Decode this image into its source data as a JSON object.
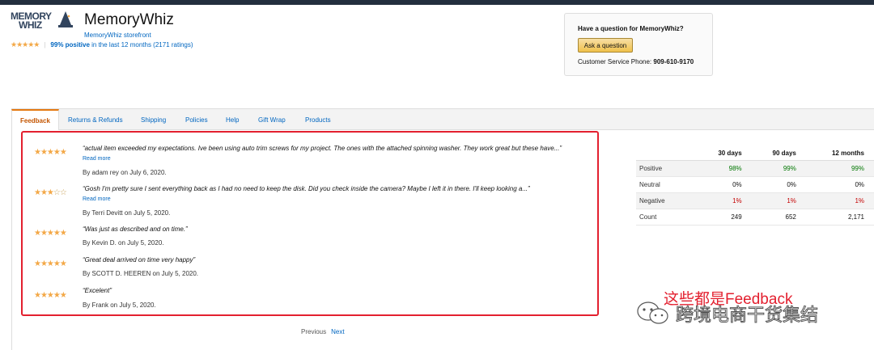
{
  "store": {
    "logo_line1": "MEMORY",
    "logo_line2": "WHIZ",
    "name": "MemoryWhiz",
    "storefront_link": "MemoryWhiz storefront",
    "rating_stars": "★★★★★",
    "positive": "99% positive",
    "rating_tail": "in the last 12 months (2171 ratings)"
  },
  "question_box": {
    "title": "Have a question for MemoryWhiz?",
    "ask_button": "Ask a question",
    "phone_label": "Customer Service Phone:",
    "phone": "909-610-9170"
  },
  "tabs": [
    "Feedback",
    "Returns & Refunds",
    "Shipping",
    "Policies",
    "Help",
    "Gift Wrap",
    "Products"
  ],
  "feedback": [
    {
      "stars": "★★★★★",
      "quote": "“actual item exceeded my expectations. Ive been using auto trim screws for my project. The ones with the attached spinning washer. They work great but these have...”",
      "read_more": "Read more",
      "by": "By adam rey on July 6, 2020.",
      "rating": 5
    },
    {
      "stars": "★★★",
      "empty_stars": "☆☆",
      "quote": "“Gosh I'm pretty sure I sent everything back as I had no need to keep the disk. Did you check inside the camera? Maybe I left it in there. I'll keep looking a...”",
      "read_more": "Read more",
      "by": "By Terri Devitt on July 5, 2020.",
      "rating": 3
    },
    {
      "stars": "★★★★★",
      "quote": "“Was just as described and on time.”",
      "by": "By Kevin D. on July 5, 2020.",
      "rating": 5
    },
    {
      "stars": "★★★★★",
      "quote": "“Great deal arrived on time very happy”",
      "by": "By SCOTT D. HEEREN on July 5, 2020.",
      "rating": 5
    },
    {
      "stars": "★★★★★",
      "quote": "“Excelent”",
      "by": "By Frank on July 5, 2020.",
      "rating": 5
    }
  ],
  "stats": {
    "headers": [
      "",
      "30 days",
      "90 days",
      "12 months"
    ],
    "rows": [
      {
        "label": "Positive",
        "values": [
          "98%",
          "99%",
          "99%"
        ]
      },
      {
        "label": "Neutral",
        "values": [
          "0%",
          "0%",
          "0%"
        ]
      },
      {
        "label": "Negative",
        "values": [
          "1%",
          "1%",
          "1%"
        ]
      },
      {
        "label": "Count",
        "values": [
          "249",
          "652",
          "2,171"
        ]
      }
    ]
  },
  "pager": {
    "previous": "Previous",
    "next": "Next"
  },
  "overlay": {
    "annotation": "这些都是Feedback",
    "watermark": "跨境电商干货集结"
  },
  "colors": {
    "accent": "#e47911",
    "link": "#0066c0",
    "star": "#f3a847",
    "annotation": "#e3202f",
    "positive": "#007600",
    "negative": "#c40000"
  }
}
